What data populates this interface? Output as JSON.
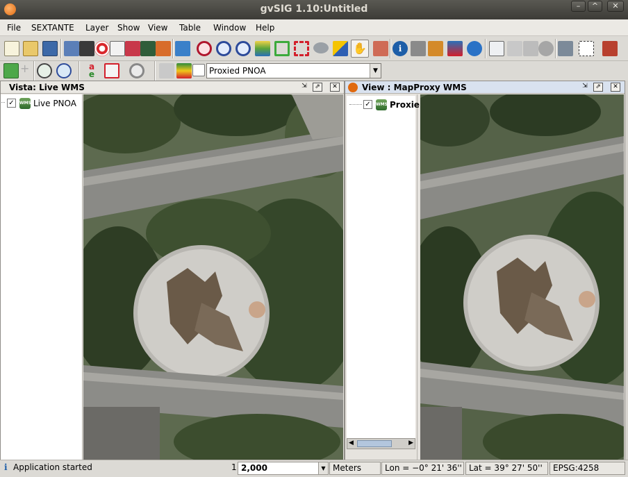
{
  "window": {
    "title": "gvSIG 1.10:Untitled",
    "controls": [
      "–",
      "^",
      "✕"
    ]
  },
  "menu": [
    "File",
    "SEXTANTE",
    "Layer",
    "Show",
    "View",
    "Table",
    "Window",
    "Help"
  ],
  "layer_combo": {
    "value": "Proxied PNOA"
  },
  "views": [
    {
      "title": "Vista: Live WMS",
      "layers": [
        {
          "name": "Live PNOA",
          "checked": true,
          "icon": "wms-layer-icon"
        }
      ]
    },
    {
      "title": "View : MapProxy WMS",
      "layers": [
        {
          "name": "Proxie",
          "checked": true,
          "icon": "wms-layer-icon"
        }
      ]
    }
  ],
  "status": {
    "message": "Application started",
    "scale_prefix": "1:",
    "scale_value": "2,000",
    "units": "Meters",
    "lon": "Lon = −0° 21' 36''",
    "lat": "Lat = 39° 27' 50''",
    "epsg": "EPSG:4258"
  },
  "colors": {
    "titlebar": "#3c3b37",
    "map_bg": "#5d6a4f",
    "accent": "#e06a10"
  }
}
